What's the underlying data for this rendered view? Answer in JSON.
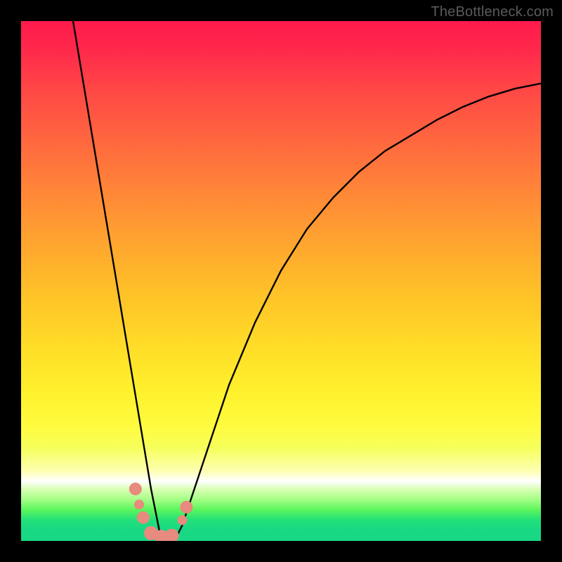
{
  "watermark": {
    "text": "TheBottleneck.com"
  },
  "chart_data": {
    "type": "line",
    "title": "",
    "xlabel": "",
    "ylabel": "",
    "xlim": [
      0,
      100
    ],
    "ylim": [
      0,
      100
    ],
    "grid": false,
    "legend": false,
    "background": "rainbow-vertical-gradient",
    "notes": "V-shaped bottleneck curve; minimum at x≈27 y≈0. Curve values estimated from pixel positions.",
    "series": [
      {
        "name": "bottleneck-curve",
        "x": [
          10,
          12,
          14,
          16,
          18,
          20,
          21,
          22,
          23,
          24,
          25,
          26,
          27,
          28,
          29,
          30,
          31,
          32,
          34,
          36,
          40,
          45,
          50,
          55,
          60,
          65,
          70,
          75,
          80,
          85,
          90,
          95,
          100
        ],
        "y": [
          100,
          88,
          76,
          64,
          52,
          40,
          34,
          28,
          22,
          16,
          10,
          5,
          0,
          0,
          0,
          1,
          3,
          6,
          12,
          18,
          30,
          42,
          52,
          60,
          66,
          71,
          75,
          78,
          81,
          83.5,
          85.5,
          87,
          88
        ]
      }
    ],
    "markers": [
      {
        "shape": "circle",
        "x": 22.0,
        "y": 10.0,
        "r": 9,
        "fill": "#e88a7e"
      },
      {
        "shape": "circle",
        "x": 22.7,
        "y": 7.0,
        "r": 7,
        "fill": "#e88a7e"
      },
      {
        "shape": "circle",
        "x": 23.5,
        "y": 4.5,
        "r": 9,
        "fill": "#e88a7e"
      },
      {
        "shape": "circle",
        "x": 25.0,
        "y": 1.5,
        "r": 10,
        "fill": "#e88a7e"
      },
      {
        "shape": "circle",
        "x": 27.0,
        "y": 0.8,
        "r": 10,
        "fill": "#e88a7e"
      },
      {
        "shape": "circle",
        "x": 29.0,
        "y": 1.0,
        "r": 10,
        "fill": "#e88a7e"
      },
      {
        "shape": "circle",
        "x": 31.0,
        "y": 4.0,
        "r": 7,
        "fill": "#e88a7e"
      },
      {
        "shape": "circle",
        "x": 31.8,
        "y": 6.5,
        "r": 9,
        "fill": "#e88a7e"
      }
    ]
  }
}
